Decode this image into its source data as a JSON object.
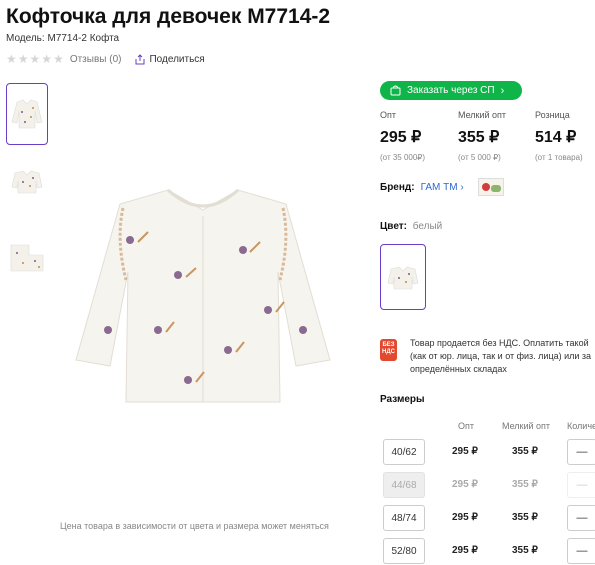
{
  "product": {
    "title": "Кофточка для девочек M7714-2",
    "model": "Модель: M7714-2 Кофта",
    "reviews": "Отзывы (0)",
    "share": "Поделиться"
  },
  "order_button": "Заказать через СП",
  "prices": [
    {
      "label": "Опт",
      "value": "295 ₽",
      "note": "(от 35 000₽)"
    },
    {
      "label": "Мелкий опт",
      "value": "355 ₽",
      "note": "(от 5 000 ₽)"
    },
    {
      "label": "Розница",
      "value": "514 ₽",
      "note": "(от 1 товара)"
    }
  ],
  "brand": {
    "label": "Бренд:",
    "value": "ГАМ ТМ",
    "chevron": "›"
  },
  "color": {
    "label": "Цвет:",
    "value": "белый"
  },
  "vat": {
    "icon_text": "БЕЗ НДС",
    "text": "Товар продается без НДС. Оплатить такой (как от юр. лица, так и от физ. лица) или за определённых складах"
  },
  "sizes": {
    "title": "Размеры",
    "headers": {
      "opt": "Опт",
      "small_opt": "Мелкий опт",
      "qty": "Количество"
    },
    "rows": [
      {
        "size": "40/62",
        "opt": "295 ₽",
        "small_opt": "355 ₽",
        "qty": "—"
      },
      {
        "size": "44/68",
        "opt": "295 ₽",
        "small_opt": "355 ₽",
        "qty": "—"
      },
      {
        "size": "48/74",
        "opt": "295 ₽",
        "small_opt": "355 ₽",
        "qty": "—"
      },
      {
        "size": "52/80",
        "opt": "295 ₽",
        "small_opt": "355 ₽",
        "qty": "—"
      }
    ]
  },
  "price_note": "Цена товара в зависимости от цвета и размера может меняться",
  "icons": {
    "star": "star-icon",
    "share": "share-icon",
    "cart": "cart-icon",
    "arrow": "chevron-right-icon"
  },
  "colors": {
    "accent": "#6a3ec8",
    "order": "#10b54a",
    "brand_link": "#2e6ad1",
    "vat": "#e2492f"
  }
}
